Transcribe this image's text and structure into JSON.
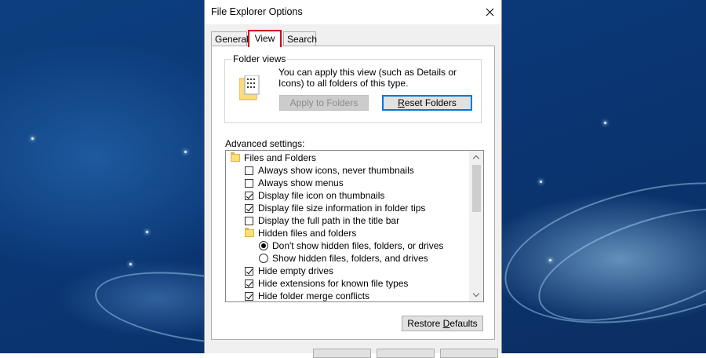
{
  "window": {
    "title": "File Explorer Options"
  },
  "tabs": [
    {
      "label": "General",
      "selected": false
    },
    {
      "label": "View",
      "selected": true
    },
    {
      "label": "Search",
      "selected": false
    }
  ],
  "folder_views": {
    "group_label": "Folder views",
    "description": "You can apply this view (such as Details or Icons) to all folders of this type.",
    "apply_button": "Apply to Folders",
    "apply_enabled": false,
    "reset_button": "Reset Folders"
  },
  "advanced": {
    "label": "Advanced settings:",
    "items": [
      {
        "type": "folder",
        "indent": 0,
        "label": "Files and Folders"
      },
      {
        "type": "checkbox",
        "indent": 1,
        "label": "Always show icons, never thumbnails",
        "checked": false
      },
      {
        "type": "checkbox",
        "indent": 1,
        "label": "Always show menus",
        "checked": false
      },
      {
        "type": "checkbox",
        "indent": 1,
        "label": "Display file icon on thumbnails",
        "checked": true
      },
      {
        "type": "checkbox",
        "indent": 1,
        "label": "Display file size information in folder tips",
        "checked": true
      },
      {
        "type": "checkbox",
        "indent": 1,
        "label": "Display the full path in the title bar",
        "checked": false
      },
      {
        "type": "folder",
        "indent": 1,
        "label": "Hidden files and folders"
      },
      {
        "type": "radio",
        "indent": 2,
        "label": "Don't show hidden files, folders, or drives",
        "checked": true
      },
      {
        "type": "radio",
        "indent": 2,
        "label": "Show hidden files, folders, and drives",
        "checked": false
      },
      {
        "type": "checkbox",
        "indent": 1,
        "label": "Hide empty drives",
        "checked": true
      },
      {
        "type": "checkbox",
        "indent": 1,
        "label": "Hide extensions for known file types",
        "checked": true
      },
      {
        "type": "checkbox",
        "indent": 1,
        "label": "Hide folder merge conflicts",
        "checked": true
      }
    ]
  },
  "restore_button": "Restore Defaults",
  "colors": {
    "highlight_border": "#d4001a",
    "focus_border": "#0078d7"
  }
}
